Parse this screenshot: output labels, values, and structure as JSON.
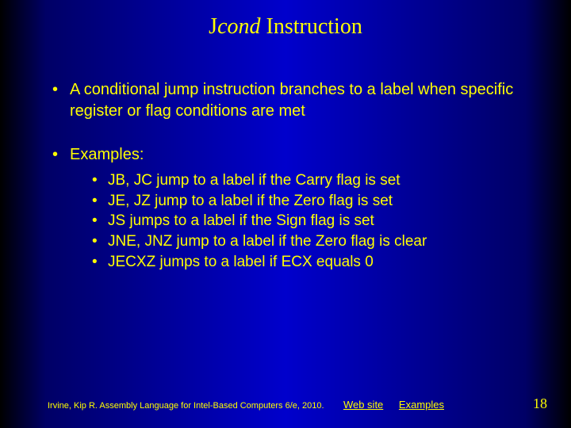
{
  "title_prefix": "J",
  "title_cond": "cond",
  "title_suffix": " Instruction",
  "bullets": {
    "intro": "A conditional jump instruction branches to a label when specific register or flag conditions are met",
    "examples_label": "Examples:",
    "examples": [
      "JB, JC jump to a label if the Carry flag is set",
      "JE, JZ jump to a label if the Zero flag is set",
      "JS jumps to a label if the Sign flag is set",
      "JNE, JNZ jump to a label if the Zero flag is clear",
      "JECXZ jumps to a label if ECX equals 0"
    ]
  },
  "footer": {
    "credit": "Irvine, Kip R. Assembly Language for Intel-Based Computers 6/e, 2010.",
    "link1": "Web site",
    "link2": "Examples"
  },
  "page_number": "18"
}
